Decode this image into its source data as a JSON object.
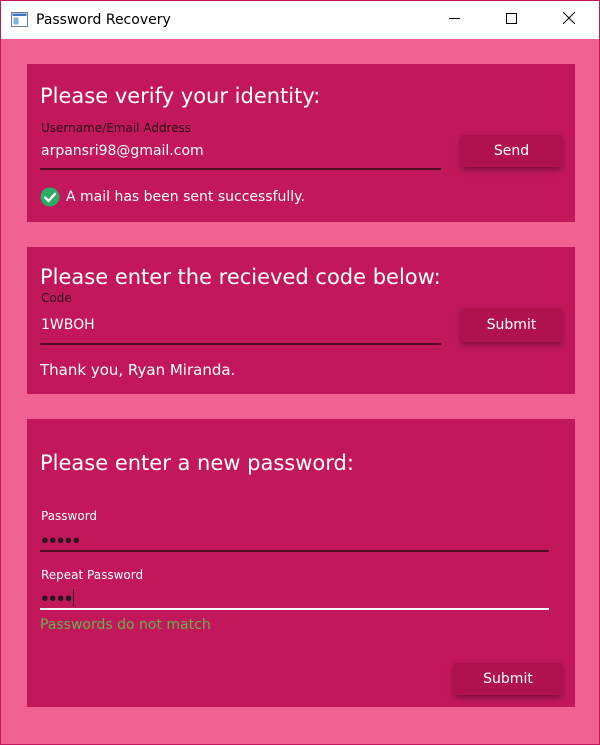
{
  "window": {
    "title": "Password Recovery",
    "icon": "app-window-icon",
    "controls": [
      "minimize-icon",
      "maximize-icon",
      "close-icon"
    ]
  },
  "verify": {
    "heading": "Please verify your identity:",
    "field_label": "Username/Email Address",
    "field_value": "arpansri98@gmail.com",
    "button_label": "Send",
    "status_icon": "check-circle-icon",
    "status_text": "A mail has been sent successfully."
  },
  "code": {
    "heading": "Please enter the recieved code below:",
    "field_label": "Code",
    "field_value": "1WBOH",
    "button_label": "Submit",
    "message": "Thank you, Ryan Miranda."
  },
  "new_password": {
    "heading": "Please enter a new password:",
    "password_label": "Password",
    "password_mask": "●●●●●",
    "repeat_label": "Repeat Password",
    "repeat_mask": "●●●●",
    "error_text": "Passwords do not match",
    "button_label": "Submit"
  },
  "colors": {
    "background": "#f06292",
    "panel": "#c2185b",
    "button": "#b0124d",
    "success": "#27ae60",
    "error": "#6ab04c",
    "focus_underline": "#ffffff"
  }
}
